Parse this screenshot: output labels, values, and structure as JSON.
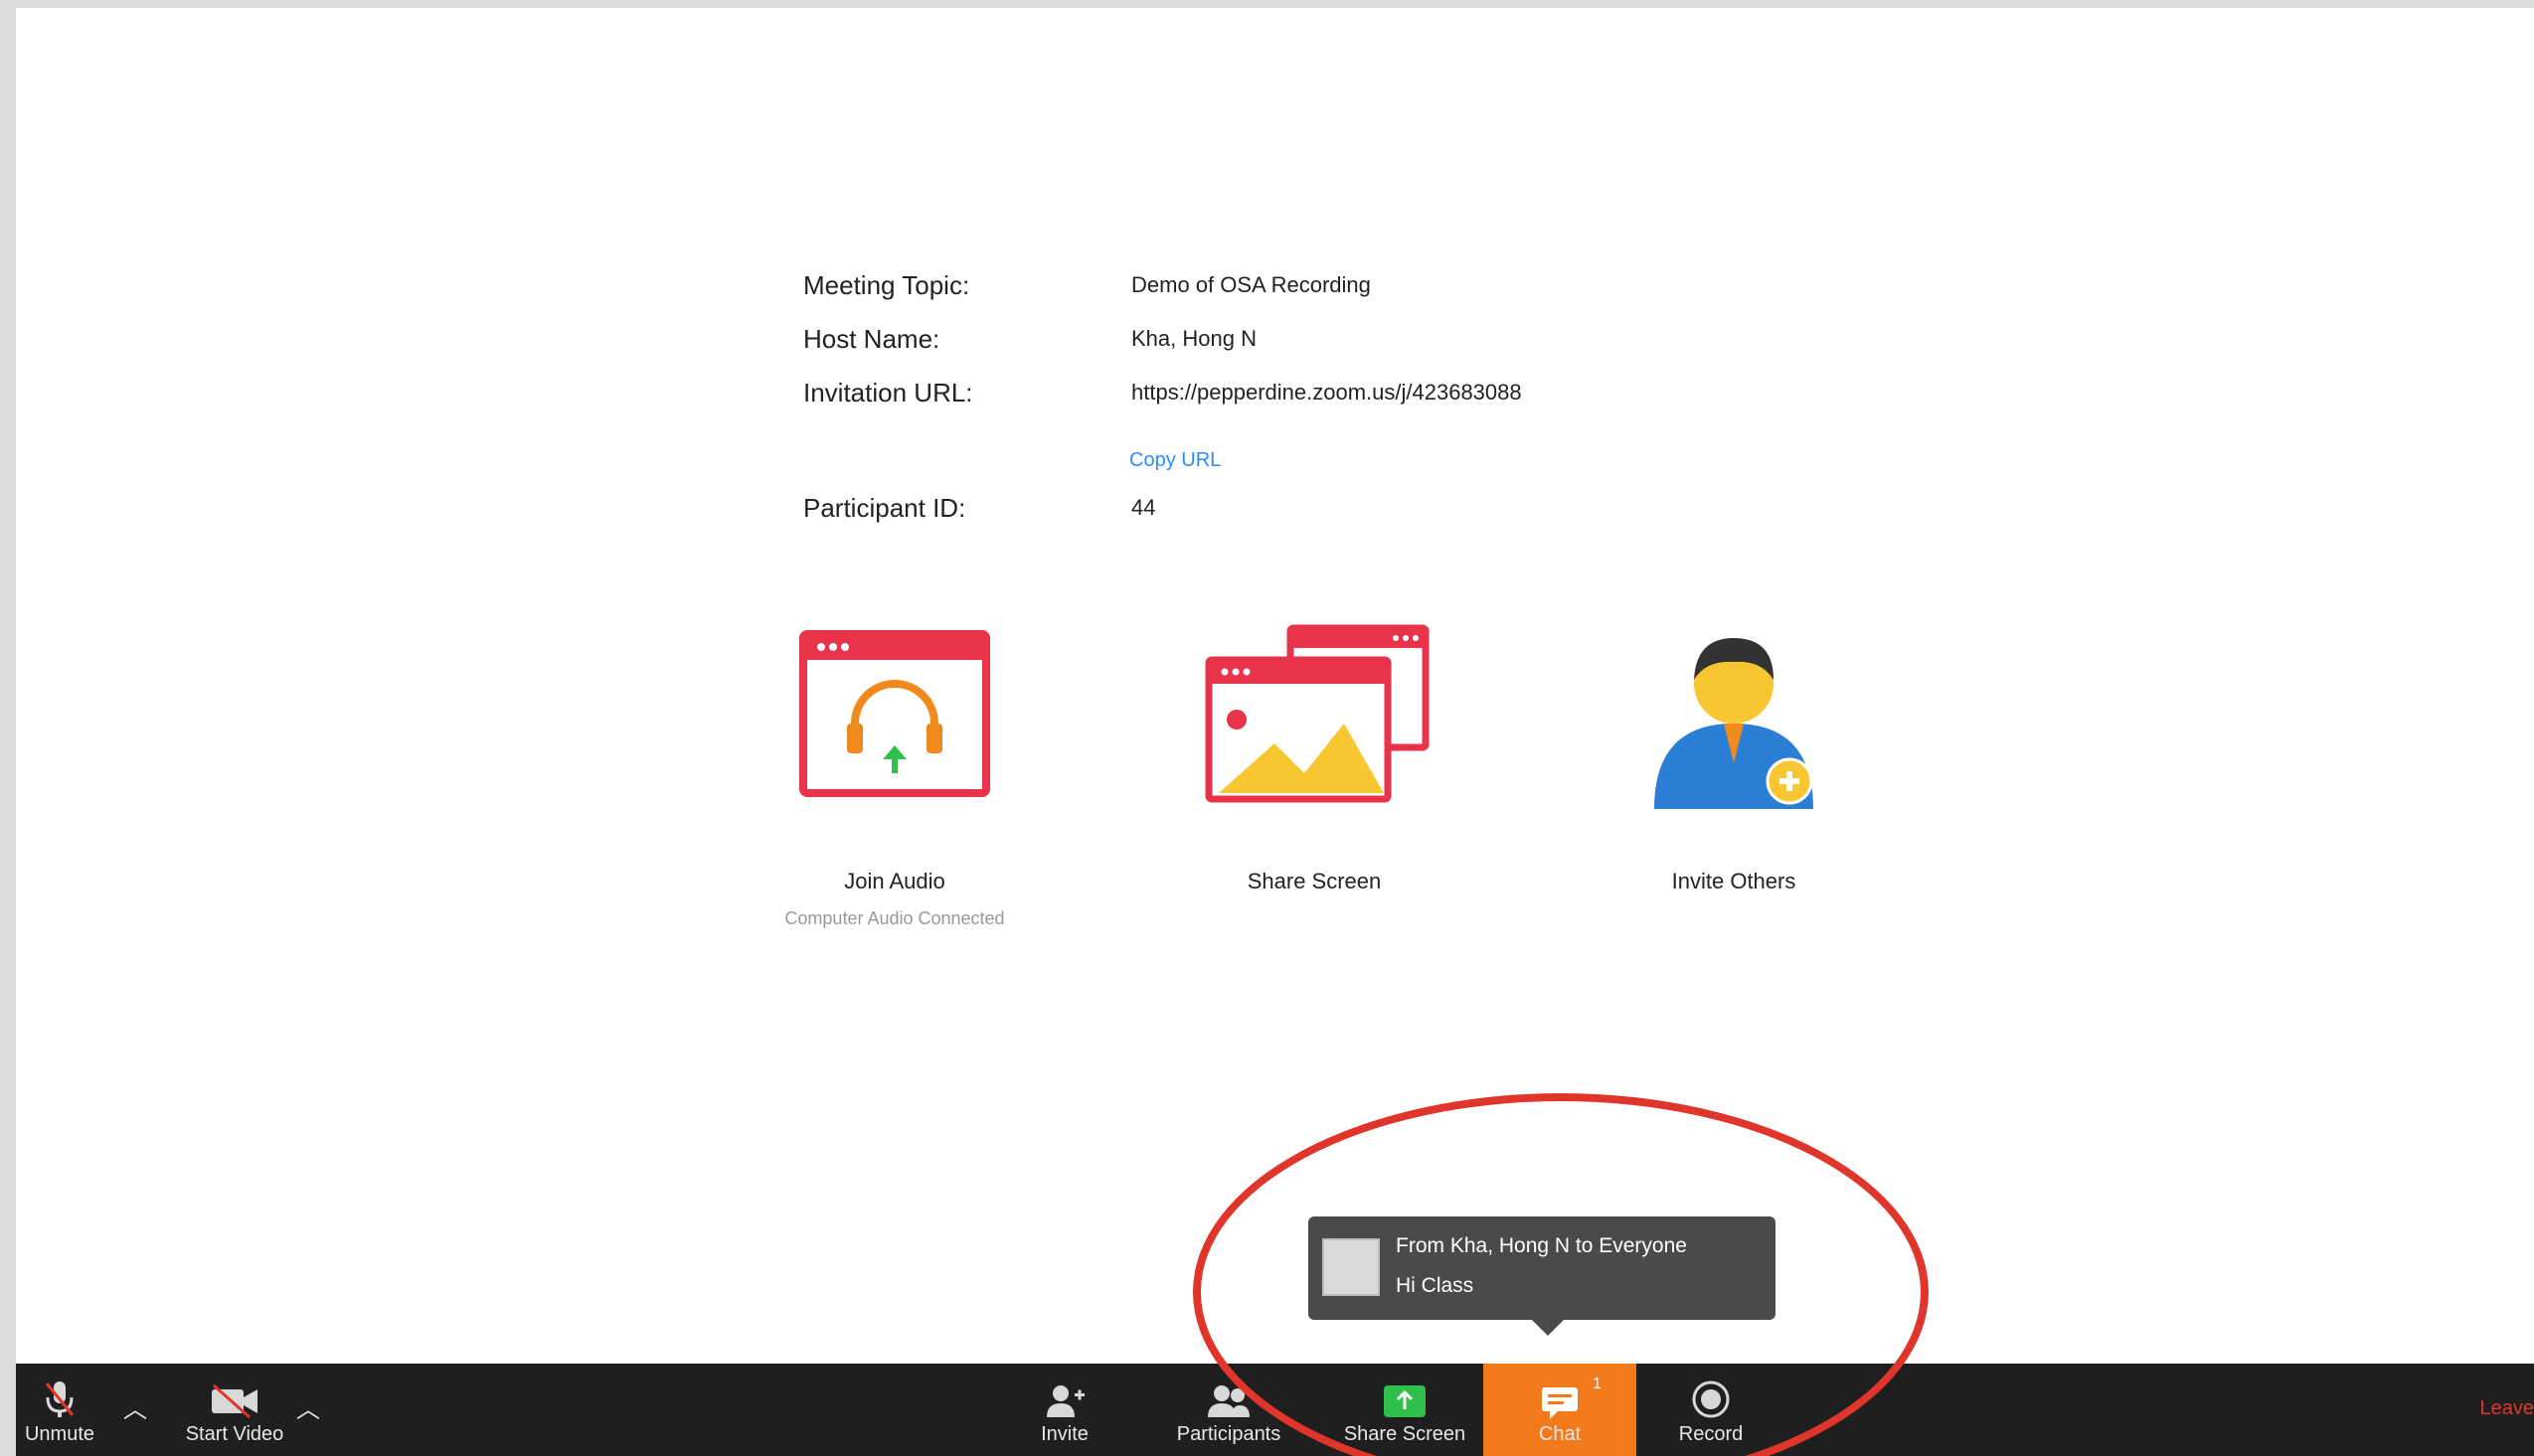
{
  "meeting": {
    "topic_label": "Meeting Topic:",
    "topic_value": "Demo of OSA Recording",
    "host_label": "Host Name:",
    "host_value": "Kha, Hong N",
    "url_label": "Invitation URL:",
    "url_value": "https://pepperdine.zoom.us/j/423683088",
    "copy_url": "Copy URL",
    "participant_label": "Participant ID:",
    "participant_value": "44"
  },
  "actions": {
    "join_audio": "Join Audio",
    "join_audio_status": "Computer Audio Connected",
    "share_screen": "Share Screen",
    "invite_others": "Invite Others"
  },
  "chat_toast": {
    "from": "From Kha, Hong N to Everyone",
    "message": "Hi Class"
  },
  "toolbar": {
    "unmute": "Unmute",
    "start_video": "Start Video",
    "invite": "Invite",
    "participants": "Participants",
    "share_screen": "Share Screen",
    "chat": "Chat",
    "chat_badge": "1",
    "record": "Record",
    "leave": "Leave"
  },
  "colors": {
    "accent_orange": "#f27a1a",
    "toolbar_bg": "#1f1f1f",
    "highlight_red": "#e0352b",
    "link_blue": "#2d8cff"
  }
}
